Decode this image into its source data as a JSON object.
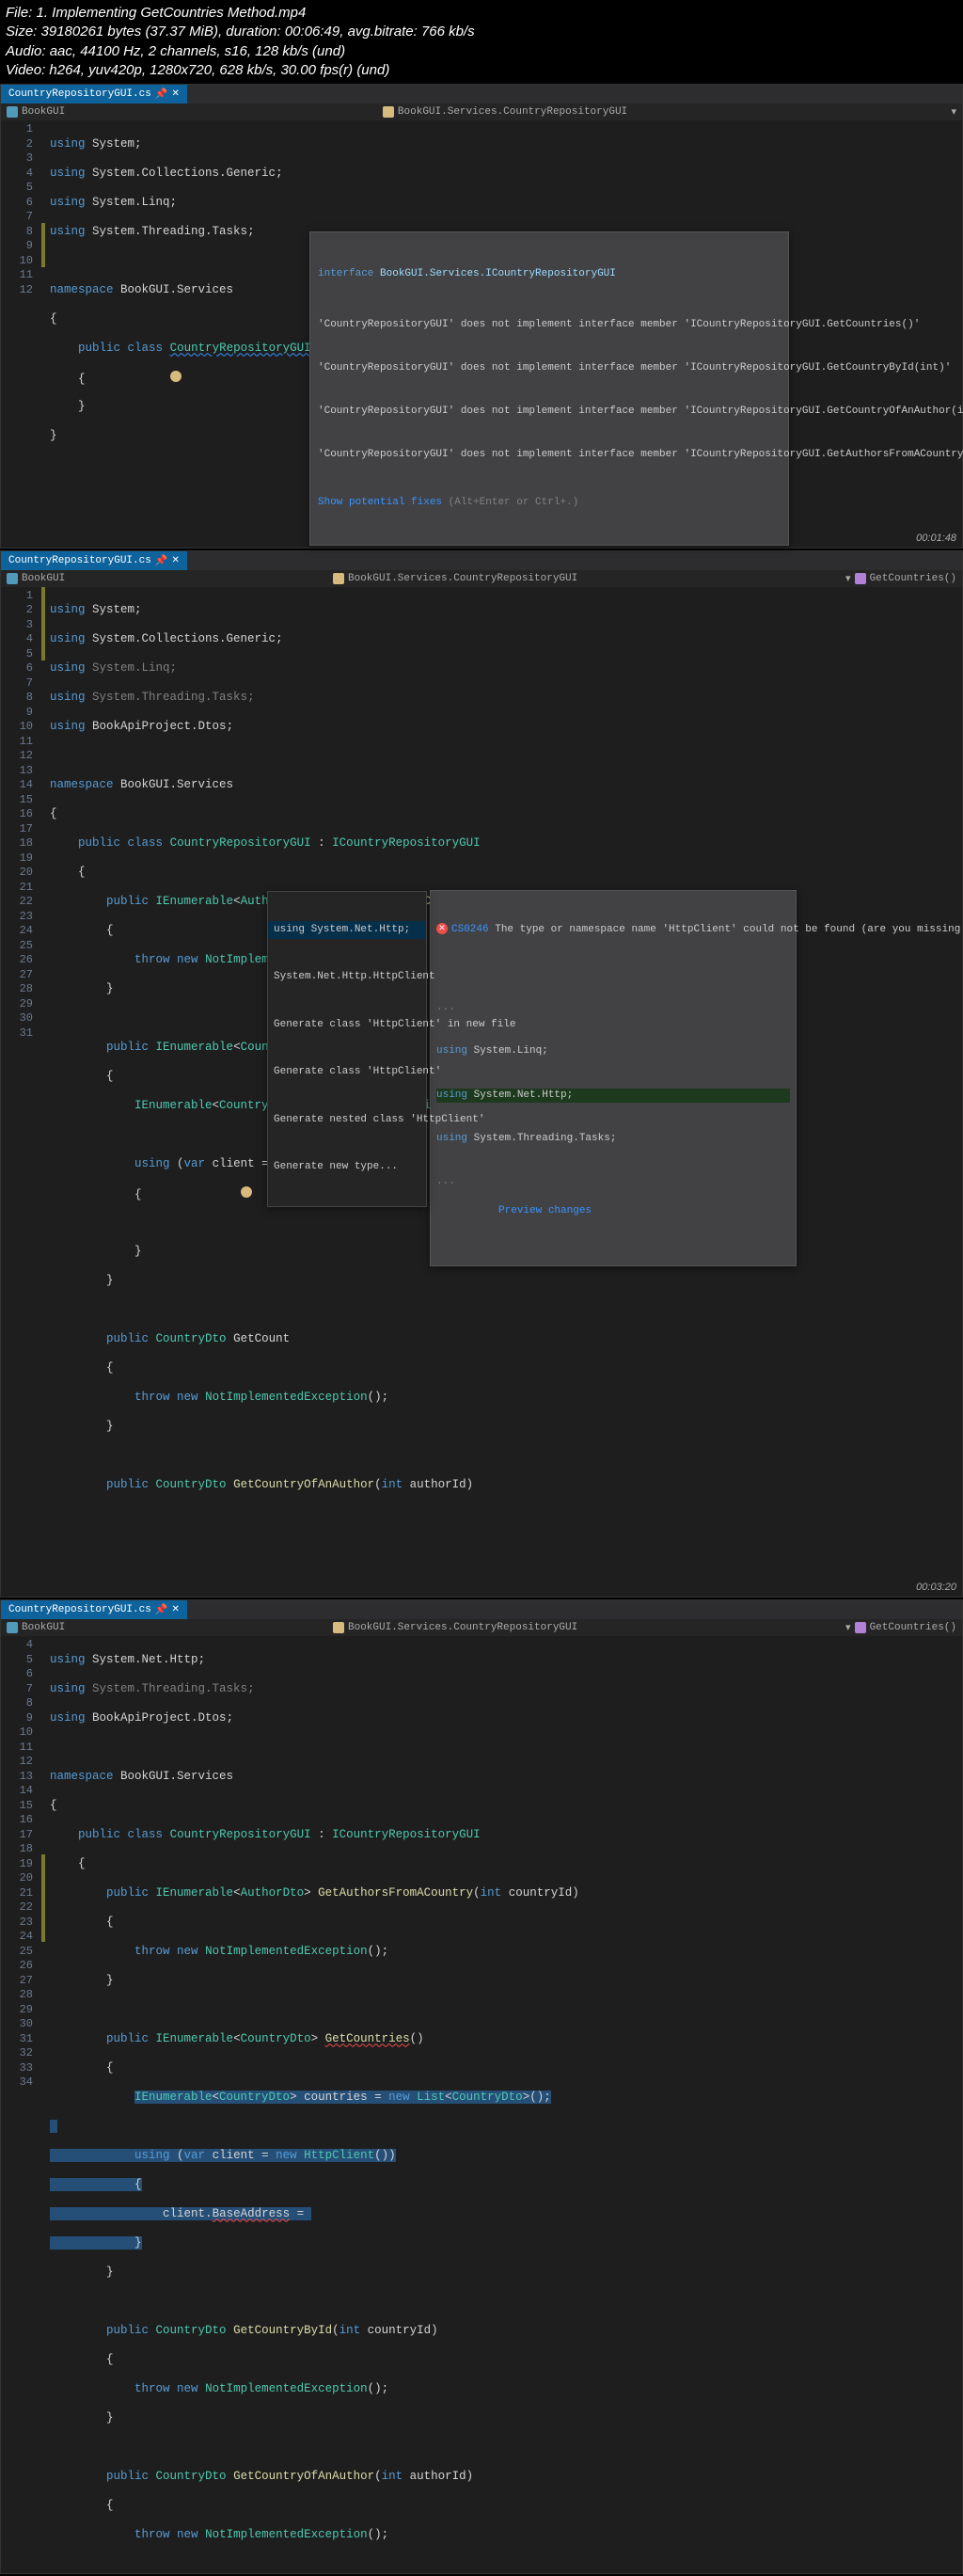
{
  "meta": {
    "l1": "File: 1. Implementing GetCountries Method.mp4",
    "l2": "Size: 39180261 bytes (37.37 MiB), duration: 00:06:49, avg.bitrate: 766 kb/s",
    "l3": "Audio: aac, 44100 Hz, 2 channels, s16, 128 kb/s (und)",
    "l4": "Video: h264, yuv420p, 1280x720, 628 kb/s, 30.00 fps(r) (und)"
  },
  "tab": {
    "name": "CountryRepositoryGUI.cs",
    "close": "✕"
  },
  "crumb": {
    "proj": "BookGUI",
    "ns": "BookGUI.Services.CountryRepositoryGUI",
    "method": "GetCountries()"
  },
  "pane1": {
    "ts": "00:01:48",
    "tooltip": {
      "hdr_kw": "interface",
      "hdr_txt": "BookGUI.Services.ICountryRepositoryGUI",
      "e1": "'CountryRepositoryGUI' does not implement interface member 'ICountryRepositoryGUI.GetCountries()'",
      "e2": "'CountryRepositoryGUI' does not implement interface member 'ICountryRepositoryGUI.GetCountryById(int)'",
      "e3": "'CountryRepositoryGUI' does not implement interface member 'ICountryRepositoryGUI.GetCountryOfAnAuthor(int)'",
      "e4": "'CountryRepositoryGUI' does not implement interface member 'ICountryRepositoryGUI.GetAuthorsFromACountry(int)'",
      "fix": "Show potential fixes",
      "fixhint": " (Alt+Enter or Ctrl+.)"
    }
  },
  "pane2": {
    "ts": "00:03:20",
    "errtip": {
      "code": "CS0246",
      "msg": "The type or namespace name 'HttpClient' could not be found (are you missing a using directive or an assembly reference?)"
    },
    "qf": {
      "i1": "using System.Net.Http;",
      "i2": "System.Net.Http.HttpClient",
      "i3": "Generate class 'HttpClient' in new file",
      "i4": "Generate class 'HttpClient'",
      "i5": "Generate nested class 'HttpClient'",
      "i6": "Generate new type..."
    },
    "preview": {
      "dots": "...",
      "l1": "using System.Linq;",
      "l2": "using System.Net.Http;",
      "l3": "using System.Threading.Tasks;",
      "link": "Preview changes"
    }
  },
  "pane3": {
    "ts": ""
  },
  "code_common": {
    "using_system": "System",
    "using_generic": "System.Collections.Generic",
    "using_linq": "System.Linq",
    "using_tasks": "System.Threading.Tasks",
    "using_dtos": "BookApiProject.Dtos",
    "using_http": "System.Net.Http",
    "ns": "BookGUI.Services",
    "cls": "CountryRepositoryGUI",
    "iface": "ICountryRepositoryGUI",
    "author_dto": "AuthorDto",
    "country_dto": "CountryDto",
    "getauthors": "GetAuthorsFromACountry",
    "getcountries": "GetCountries",
    "getcountrybyid": "GetCountryById",
    "getcountryofauthor": "GetCountryOfAnAuthor",
    "countryid": "countryId",
    "authorid": "authorId",
    "countries": "countries",
    "client": "client",
    "httpclient": "HttpClient",
    "ienum": "IEnumerable",
    "list": "List",
    "notimpl": "NotImplementedException",
    "baseaddr": "BaseAddress",
    "throw": "throw",
    "new": "new",
    "public": "public",
    "class": "class",
    "namespace": "namespace",
    "using": "using",
    "int": "int",
    "var": "var",
    "void": ""
  }
}
